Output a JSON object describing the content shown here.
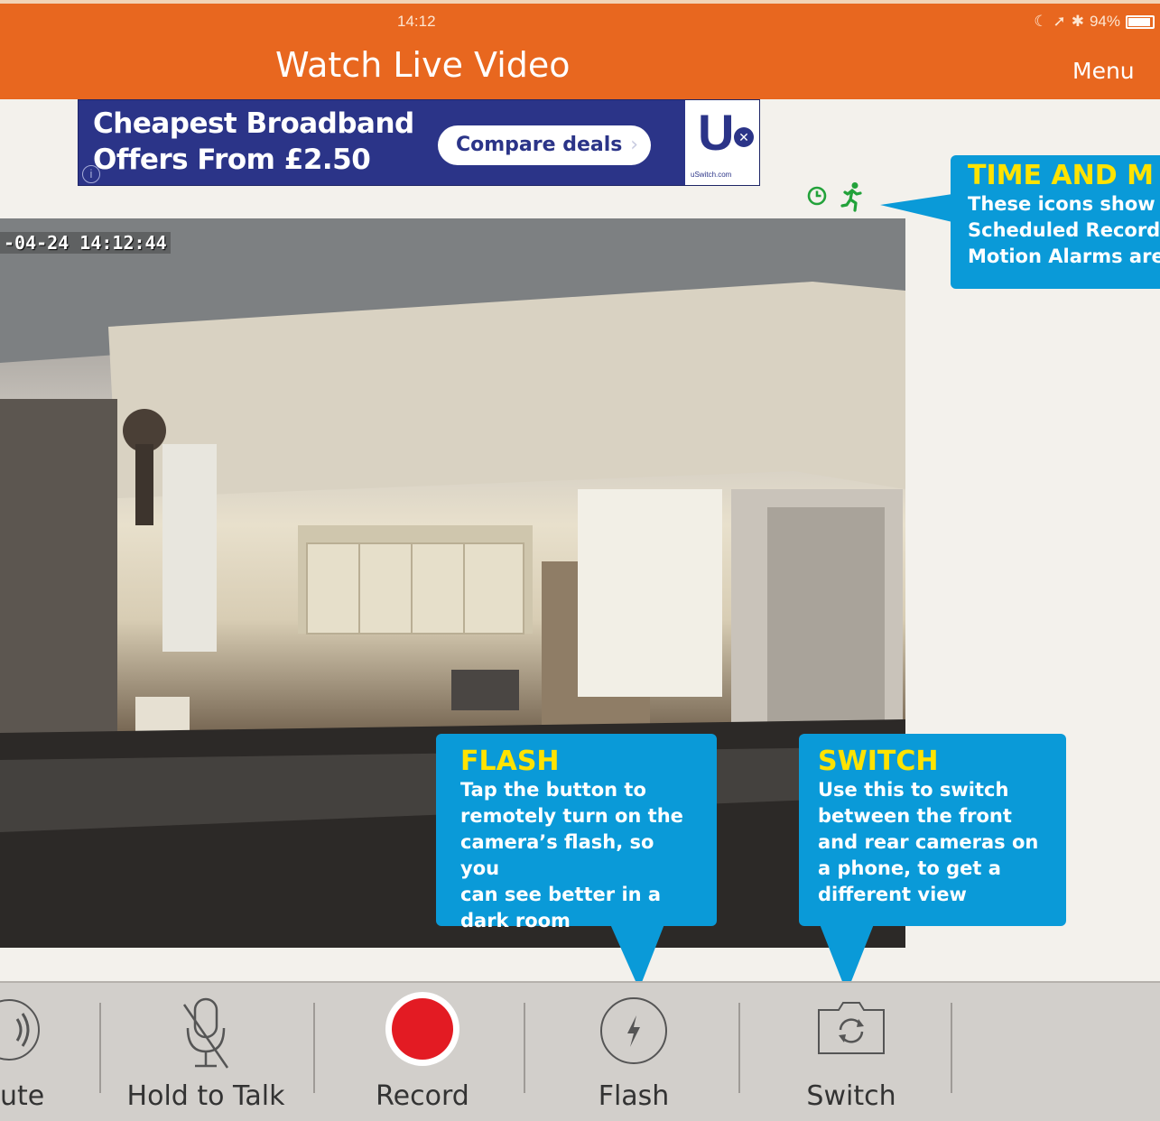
{
  "status_bar": {
    "time": "14:12",
    "battery": "94%"
  },
  "header": {
    "title": "Watch Live Video",
    "menu_label": "Menu"
  },
  "ad": {
    "line1": "Cheapest Broadband",
    "line2": "Offers From £2.50",
    "button_label": "Compare deals",
    "brand": "uSwitch.com"
  },
  "video": {
    "timestamp": "-04-24  14:12:44"
  },
  "toolbar": {
    "items": [
      {
        "label": "ute",
        "icon": "speaker-icon"
      },
      {
        "label": "Hold to Talk",
        "icon": "microphone-muted-icon"
      },
      {
        "label": "Record",
        "icon": "record-icon"
      },
      {
        "label": "Flash",
        "icon": "lightning-icon"
      },
      {
        "label": "Switch",
        "icon": "camera-switch-icon"
      }
    ]
  },
  "callouts": {
    "time_motion": {
      "title": "TIME AND M",
      "lines": [
        "These icons show",
        "Scheduled Record",
        "Motion Alarms are"
      ]
    },
    "flash": {
      "title": "FLASH",
      "lines": [
        "Tap the button to",
        "remotely turn on the",
        "camera’s flash, so you",
        "can see better in a",
        "dark room"
      ]
    },
    "switch": {
      "title": "SWITCH",
      "lines": [
        "Use this to switch",
        "between the front",
        "and rear cameras on",
        "a phone, to get a",
        "different view"
      ]
    }
  },
  "colors": {
    "header": "#e8671f",
    "callout": "#0a9ad8",
    "callout_title": "#ffe300",
    "record": "#e31b23",
    "mode_icons": "#22a23a"
  }
}
